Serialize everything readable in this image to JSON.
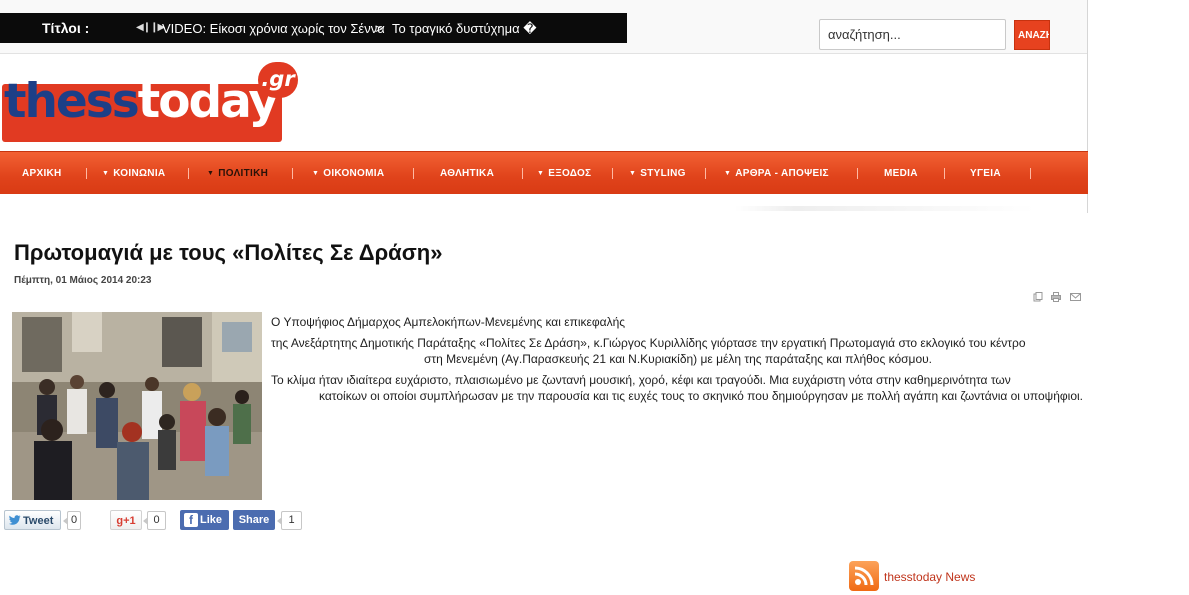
{
  "ticker": {
    "label": "Τίτλοι :",
    "items": [
      "VIDEO: Είκοσι χρόνια χωρίς τον Σέννα",
      "Το τραγικό δυστύχημα �"
    ],
    "separator": ">"
  },
  "search": {
    "placeholder": "αναζήτηση...",
    "button_label": "ΑΝΑΖΗΤΗΣΗ"
  },
  "logo": {
    "part1": "thess",
    "part2": "today",
    "tld": ".gr"
  },
  "nav": {
    "items": [
      {
        "label": "ΑΡΧΙΚΗ",
        "dropdown": false
      },
      {
        "label": "ΚΟΙΝΩΝΙΑ",
        "dropdown": true
      },
      {
        "label": "ΠΟΛΙΤΙΚΗ",
        "dropdown": true,
        "active": true
      },
      {
        "label": "ΟΙΚΟΝΟΜΙΑ",
        "dropdown": true
      },
      {
        "label": "ΑΘΛΗΤΙΚΑ",
        "dropdown": false
      },
      {
        "label": "ΕΞΟΔΟΣ",
        "dropdown": true
      },
      {
        "label": "STYLING",
        "dropdown": true
      },
      {
        "label": "ΑΡΘΡΑ - ΑΠΟΨΕΙΣ",
        "dropdown": true
      },
      {
        "label": "MEDIA",
        "dropdown": false
      },
      {
        "label": "ΥΓΕΙΑ",
        "dropdown": false
      }
    ],
    "colors": {
      "bar": "#e0431b",
      "active_text": "#2a1208"
    }
  },
  "article": {
    "title": "Πρωτομαγιά με τους «Πολίτες Σε Δράση»",
    "date": "Πέμπτη, 01 Μάιος 2014 20:23",
    "paragraph1": "Ο Υποψήφιος Δήμαρχος Αμπελοκήπων-Μενεμένης και επικεφαλής",
    "paragraph2_line1": "της Ανεξάρτητης Δημοτικής Παράταξης «Πολίτες Σε Δράση», κ.Γιώργος Κυριλλίδης  γιόρτασε την εργατική Πρωτομαγιά στο εκλογικό του κέντρο",
    "paragraph2_line2": "στη Μενεμένη (Αγ.Παρασκευής 21 και Ν.Κυριακίδη) με μέλη της παράταξης και πλήθος κόσμου.",
    "paragraph3_line1": "Το κλίμα ήταν ιδιαίτερα ευχάριστο, πλαισιωμένο με ζωντανή μουσική, χορό, κέφι και τραγούδι. Μια ευχάριστη νότα στην καθημερινότητα των",
    "paragraph3_line2": "κατοίκων οι οποίοι  συμπλήρωσαν με την παρουσία και τις ευχές τους το σκηνικό που δημιούργησαν με πολλή αγάπη και ζωντάνια οι υποψήφιοι.",
    "tool_icons": [
      "pdf-icon",
      "print-icon",
      "email-icon"
    ]
  },
  "social": {
    "tweet_label": "Tweet",
    "tweet_count": "0",
    "gplus_label": "g+1",
    "gplus_count": "0",
    "fb_like_label": "Like",
    "fb_share_label": "Share",
    "fb_count": "1"
  },
  "feed": {
    "label": "thesstoday News",
    "icon": "rss-icon"
  }
}
